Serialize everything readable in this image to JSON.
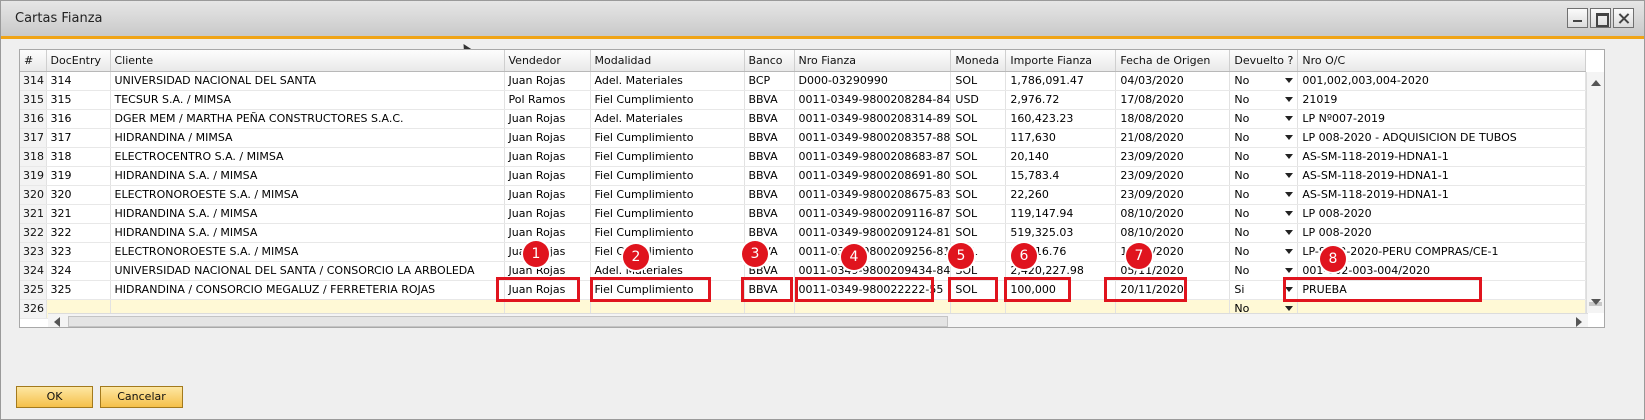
{
  "window": {
    "title": "Cartas Fianza",
    "controls": [
      "minimize-icon",
      "maximize-icon",
      "close-icon"
    ]
  },
  "grid": {
    "columns": [
      "#",
      "DocEntry",
      "Cliente",
      "Vendedor",
      "Modalidad",
      "Banco",
      "Nro Fianza",
      "Moneda",
      "Importe Fianza",
      "Fecha de Origen",
      "Devuelto ?",
      "Nro O/C"
    ],
    "rows": [
      [
        "314",
        "314",
        "UNIVERSIDAD NACIONAL DEL SANTA",
        "Juan Rojas",
        "Adel. Materiales",
        "BCP",
        "D000-03290990",
        "SOL",
        "1,786,091.47",
        "04/03/2020",
        "No",
        "001,002,003,004-2020"
      ],
      [
        "315",
        "315",
        "TECSUR S.A. / MIMSA",
        "Pol Ramos",
        "Fiel Cumplimiento",
        "BBVA",
        "0011-0349-9800208284-84",
        "USD",
        "2,976.72",
        "17/08/2020",
        "No",
        "21019"
      ],
      [
        "316",
        "316",
        "DGER MEM / MARTHA PEÑA CONSTRUCTORES S.A.C.",
        "Juan Rojas",
        "Adel. Materiales",
        "BBVA",
        "0011-0349-9800208314-89",
        "SOL",
        "160,423.23",
        "18/08/2020",
        "No",
        "LP Nº007-2019"
      ],
      [
        "317",
        "317",
        "HIDRANDINA / MIMSA",
        "Juan Rojas",
        "Fiel Cumplimiento",
        "BBVA",
        "0011-0349-9800208357-88",
        "SOL",
        "117,630",
        "21/08/2020",
        "No",
        "LP 008-2020 - ADQUISICION DE TUBOS"
      ],
      [
        "318",
        "318",
        "ELECTROCENTRO S.A. / MIMSA",
        "Juan Rojas",
        "Fiel Cumplimiento",
        "BBVA",
        "0011-0349-9800208683-87",
        "SOL",
        "20,140",
        "23/09/2020",
        "No",
        "AS-SM-118-2019-HDNA1-1"
      ],
      [
        "319",
        "319",
        "HIDRANDINA S.A. / MIMSA",
        "Juan Rojas",
        "Fiel Cumplimiento",
        "BBVA",
        "0011-0349-9800208691-80",
        "SOL",
        "15,783.4",
        "23/09/2020",
        "No",
        "AS-SM-118-2019-HDNA1-1"
      ],
      [
        "320",
        "320",
        "ELECTRONOROESTE S.A. / MIMSA",
        "Juan Rojas",
        "Fiel Cumplimiento",
        "BBVA",
        "0011-0349-9800208675-83",
        "SOL",
        "22,260",
        "23/09/2020",
        "No",
        "AS-SM-118-2019-HDNA1-1"
      ],
      [
        "321",
        "321",
        "HIDRANDINA S.A. / MIMSA",
        "Juan Rojas",
        "Fiel Cumplimiento",
        "BBVA",
        "0011-0349-9800209116-87",
        "SOL",
        "119,147.94",
        "08/10/2020",
        "No",
        "LP 008-2020"
      ],
      [
        "322",
        "322",
        "HIDRANDINA S.A. / MIMSA",
        "Juan Rojas",
        "Fiel Cumplimiento",
        "BBVA",
        "0011-0349-9800209124-81",
        "SOL",
        "519,325.03",
        "08/10/2020",
        "No",
        "LP 008-2020"
      ],
      [
        "323",
        "323",
        "ELECTRONOROESTE S.A. / MIMSA",
        "Juan Rojas",
        "Fiel Cumplimiento",
        "BBVA",
        "0011-0349-9800209256-81",
        "SOL",
        "13,316.76",
        "13/10/2020",
        "No",
        "LP-SM-2-2020-PERU COMPRAS/CE-1"
      ],
      [
        "324",
        "324",
        "UNIVERSIDAD NACIONAL DEL SANTA / CONSORCIO LA ARBOLEDA",
        "Juan Rojas",
        "Adel. Materiales",
        "BBVA",
        "0011-0349-9800209434-84",
        "SOL",
        "2,420,227.98",
        "05/11/2020",
        "No",
        "001-002-003-004/2020"
      ],
      [
        "325",
        "325",
        "HIDRANDINA / CONSORCIO MEGALUZ / FERRETERIA ROJAS",
        "Juan Rojas",
        "Fiel Cumplimiento",
        "BBVA",
        "0011-0349-980022222-55",
        "SOL",
        "100,000",
        "20/11/2020",
        "Si",
        "PRUEBA"
      ],
      [
        "326",
        "",
        "",
        "",
        "",
        "",
        "",
        "",
        "",
        "",
        "No",
        ""
      ]
    ]
  },
  "annotations": [
    "1",
    "2",
    "3",
    "4",
    "5",
    "6",
    "7",
    "8"
  ],
  "buttons": {
    "ok": "OK",
    "cancel": "Cancelar"
  },
  "colors": {
    "accent_orange": "#f0a417",
    "highlight_red": "#e0141e",
    "button_fill": "#f5c04a"
  }
}
